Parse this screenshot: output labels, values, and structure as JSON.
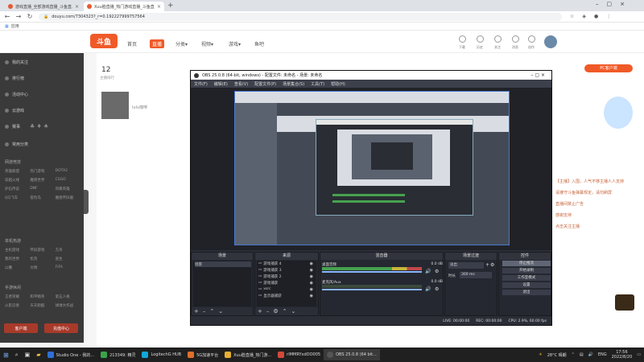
{
  "browser": {
    "tabs": [
      {
        "title": "游戏直播_全部游戏直播_斗鱼直...",
        "active": false
      },
      {
        "title": "Xuu脸直播_热门游戏直播_斗鱼直...",
        "active": true
      }
    ],
    "url": "douyu.com/7304323?_r=0.192227999757564",
    "bookmark": "应用"
  },
  "site": {
    "logo": "斗鱼",
    "nav": [
      {
        "label": "首页",
        "active": false
      },
      {
        "label": "直播",
        "active": true
      },
      {
        "label": "分类▾",
        "active": false
      },
      {
        "label": "视频▾",
        "active": false
      },
      {
        "label": "游戏▾",
        "active": false
      },
      {
        "label": "鱼吧",
        "active": false
      }
    ],
    "header_icons": [
      "下载",
      "历史",
      "关注",
      "消息",
      "创作"
    ],
    "sidebar_top": [
      {
        "label": "我的关注"
      },
      {
        "label": "排行榜"
      },
      {
        "label": "活动中心"
      },
      {
        "label": "云游戏"
      },
      {
        "label": "赛事"
      },
      {
        "label": "常用分类"
      }
    ],
    "sidebar_sections": [
      {
        "title": "网游竞技",
        "items": [
          "英雄联盟",
          "热门游戏",
          "DOTA2",
          "穿越火线",
          "魔兽世界",
          "CSGO",
          "炉石传说",
          "DNF",
          "风暴英雄",
          "QQ飞车",
          "冒险岛",
          "魔兽怀旧服"
        ]
      },
      {
        "title": "单机热游",
        "items": [
          "主机游戏",
          "怀旧游戏",
          "方舟",
          "我的世界",
          "饥荒",
          "逃生",
          "以撒",
          "文明",
          "FIFA"
        ]
      },
      {
        "title": "手游休闲",
        "items": [
          "王者荣耀",
          "和平精英",
          "第五人格",
          "火影忍者",
          "天天跑酷",
          "球球大作战"
        ]
      }
    ],
    "sidebar_buttons": [
      "客户端",
      "充值中心"
    ],
    "streamer": {
      "count": "12",
      "count_label": "主播排行",
      "name": "lulu咖啡"
    },
    "right_promo": "PC客户端",
    "right_notices": [
      "【主播】入围，人气不够主播人人支持",
      "请遵守斗鱼弹幕规定，请勿刷屏",
      "直播间禁止广告",
      "感谢支持",
      "点击关注主播"
    ]
  },
  "obs": {
    "title": "OBS 25.0.8 (64-bit, windows) - 配置文件: 未命名 - 场景: 未命名",
    "menu": [
      "文件(F)",
      "编辑(E)",
      "查看(V)",
      "配置文件(P)",
      "场景集合(S)",
      "工具(T)",
      "帮助(H)"
    ],
    "docks": {
      "scenes": {
        "title": "场景",
        "items": [
          "场景"
        ]
      },
      "sources": {
        "title": "来源",
        "items": [
          "游戏捕获 4",
          "游戏捕获 3",
          "游戏捕获 2",
          "游戏捕获",
          "xsrc",
          "显示器捕获"
        ]
      },
      "mixer": {
        "title": "混音器",
        "tracks": [
          {
            "name": "桌面音频",
            "value": "0.0 dB"
          },
          {
            "name": "麦克风/Aux",
            "value": "0.0 dB"
          }
        ]
      },
      "transitions": {
        "title": "场景过渡",
        "type": "淡出",
        "duration_label": "时长",
        "duration": "300 ms"
      },
      "controls": {
        "title": "控件",
        "buttons": [
          "停止推流",
          "开始录制",
          "工作室模式",
          "设置",
          "退出"
        ]
      }
    },
    "status": {
      "live": "LIVE: 00:00:00",
      "rec": "REC: 00:00:00",
      "cpu": "CPU: 2.9%, 60.00 fps"
    }
  },
  "taskbar": {
    "apps": [
      {
        "label": "Studio One - 我的...",
        "color": "#2f6fd6"
      },
      {
        "label": "213349: 精灵",
        "color": "#3aa34a"
      },
      {
        "label": "LogitechG HUB",
        "color": "#10a8d8"
      },
      {
        "label": "5G加速平台",
        "color": "#e0702a"
      },
      {
        "label": "Xuu脸直播_热门游...",
        "color": "#e4b02f"
      },
      {
        "label": "rIMMRYxdOO005",
        "color": "#d24a3a"
      },
      {
        "label": "OBS 25.0.8 (64 bit...",
        "color": "#555555"
      }
    ],
    "weather": "28°C 晴朗",
    "lang": "ENG",
    "time": "17:56",
    "date": "2022/8/20"
  }
}
